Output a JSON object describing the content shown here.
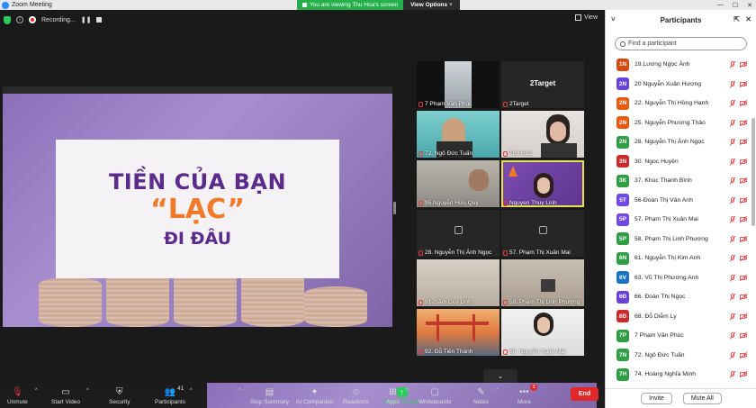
{
  "titlebar": {
    "title": "Zoom Meeting",
    "viewing": "You are viewing Thu Hoa's screen",
    "view_options": "View Options",
    "view_options_caret": "˅"
  },
  "meeting": {
    "recording_label": "Recording...",
    "view_label": "View"
  },
  "slide": {
    "line1": "TIỀN CỦA BẠN",
    "line2": "“LẠC”",
    "line3": "ĐI ĐÂU"
  },
  "tiles": [
    {
      "name": "7 Phạm Văn Phúc"
    },
    {
      "name": "2Target",
      "big": "2Target"
    },
    {
      "name": "72. Ngô Đức Tuấn"
    },
    {
      "name": "Thu Hoa"
    },
    {
      "name": "95.Nguyễn Hữu Quý"
    },
    {
      "name": "Nguyen Thuy Linh"
    },
    {
      "name": "28. Nguyễn Thị Ánh Ngọc"
    },
    {
      "name": "57. Phạm Thị Xuân Mai"
    },
    {
      "name": "91. Sầm Duy Linh"
    },
    {
      "name": "58. Phạm Thị Linh Phương"
    },
    {
      "name": "92. Đỗ Tiến Thành"
    },
    {
      "name": "60. Nguyễn Xuân Mai"
    }
  ],
  "scroll_glyph": "⌄",
  "panel": {
    "title": "Participants",
    "search_placeholder": "Find a participant",
    "invite": "Invite",
    "mute_all": "Mute All",
    "participants": [
      {
        "initials": "1N",
        "name": "19.Lương Ngọc Ánh",
        "color": "#d9480f"
      },
      {
        "initials": "2N",
        "name": "20 Nguyễn Xuân Hương",
        "color": "#6741d9"
      },
      {
        "initials": "2N",
        "name": "22. Nguyễn Thị Hồng Hạnh",
        "color": "#e8590c"
      },
      {
        "initials": "2N",
        "name": "25. Nguyễn Phương Thảo",
        "color": "#e8590c"
      },
      {
        "initials": "2N",
        "name": "28. Nguyễn Thị Ánh Ngọc",
        "color": "#2f9e44"
      },
      {
        "initials": "3N",
        "name": "30. Ngoc Huyền",
        "color": "#c92a2a"
      },
      {
        "initials": "3K",
        "name": "37. Khúc Thanh Bình",
        "color": "#2f9e44"
      },
      {
        "initials": "5T",
        "name": "56-Đoàn Thị Vân Anh",
        "color": "#7048e8"
      },
      {
        "initials": "5P",
        "name": "57. Phạm Thị Xuân Mai",
        "color": "#7048e8"
      },
      {
        "initials": "5P",
        "name": "58. Phạm Thị Linh Phương",
        "color": "#2f9e44"
      },
      {
        "initials": "6N",
        "name": "61. Nguyễn Thị Kim Anh",
        "color": "#2f9e44"
      },
      {
        "initials": "6V",
        "name": "63. Vũ Thị Phương Anh",
        "color": "#1971c2"
      },
      {
        "initials": "6Đ",
        "name": "66. Đoàn Thị Ngọc",
        "color": "#6741d9"
      },
      {
        "initials": "6Đ",
        "name": "68. Đỗ Diễm Ly",
        "color": "#c92a2a"
      },
      {
        "initials": "7P",
        "name": "7 Phạm Văn Phúc",
        "color": "#2f9e44"
      },
      {
        "initials": "7N",
        "name": "72. Ngô Đức Tuấn",
        "color": "#2f9e44"
      },
      {
        "initials": "7H",
        "name": "74. Hoàng Nghĩa Minh",
        "color": "#2f9e44"
      }
    ]
  },
  "toolbar": {
    "unmute": "Unmute",
    "start_video": "Start Video",
    "security": "Security",
    "participants": "Participants",
    "participants_count": "41",
    "share_screen": "Share Screen",
    "stop_summary": "Stop Summary",
    "ai_companion": "AI Companion",
    "reactions": "Reactions",
    "apps": "Apps",
    "whiteboards": "Whiteboards",
    "notes": "Notes",
    "more": "More",
    "more_badge": "3",
    "end": "End"
  }
}
